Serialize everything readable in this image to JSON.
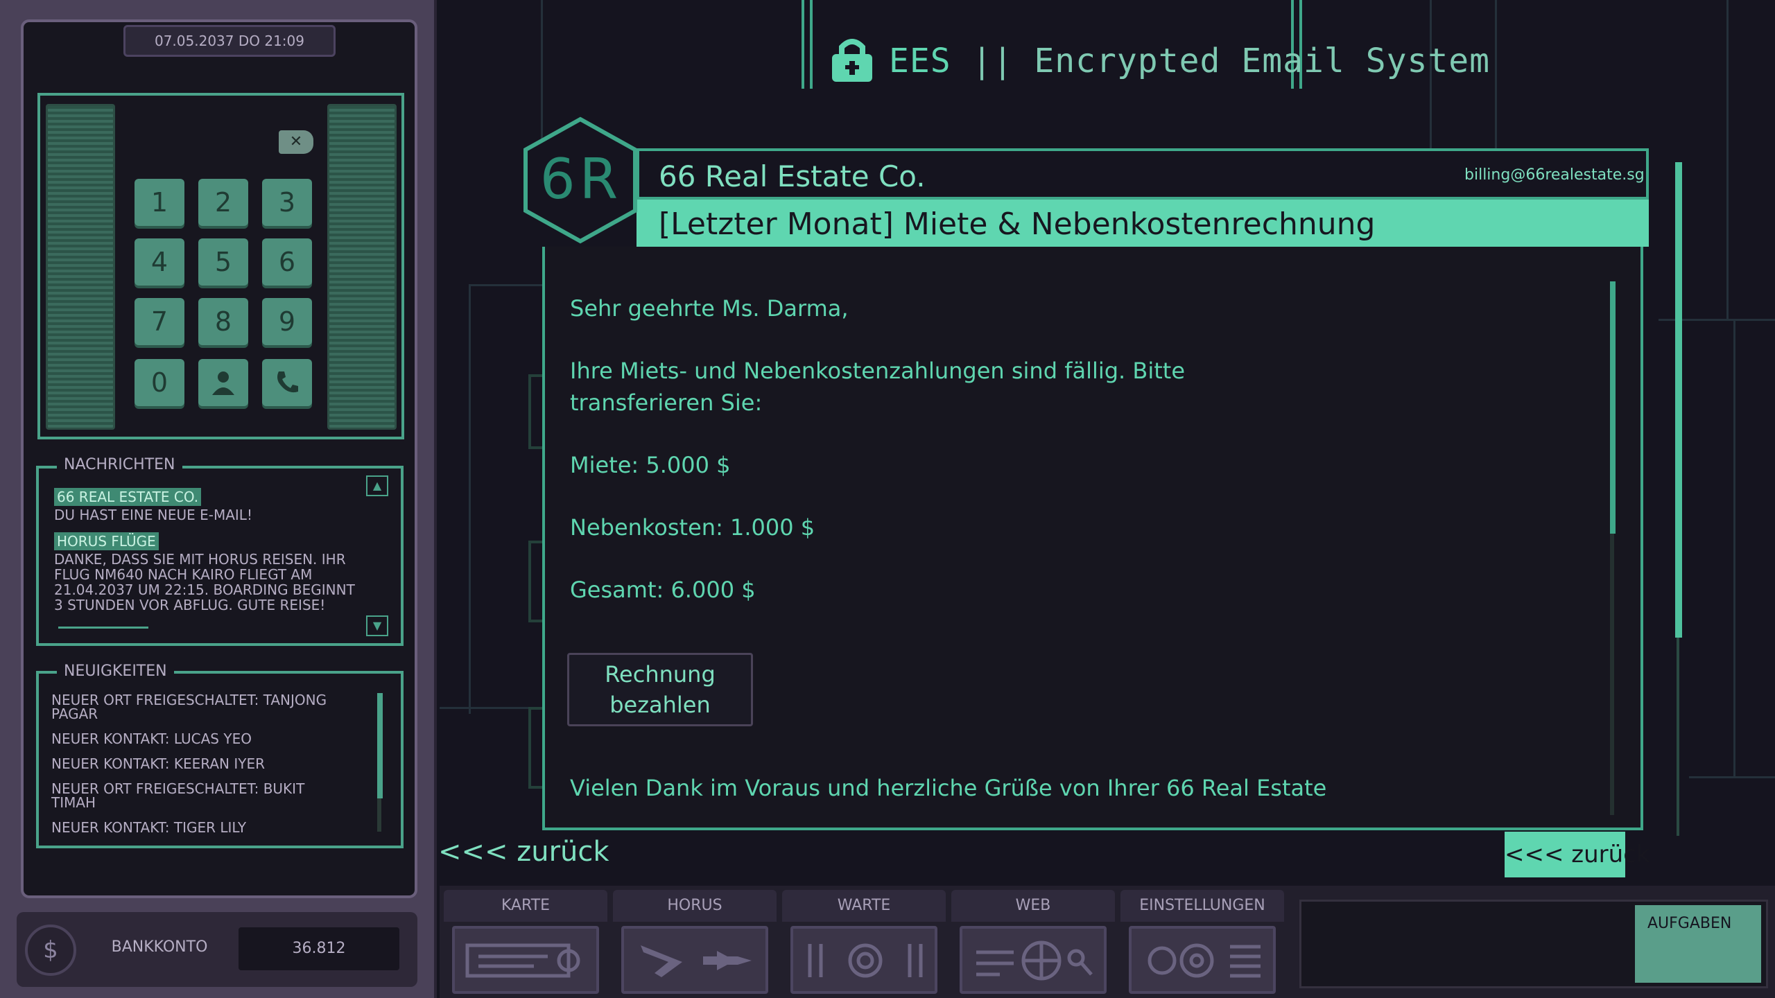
{
  "phone": {
    "datetime": "07.05.2037 DO 21:09",
    "keys": [
      "1",
      "2",
      "3",
      "4",
      "5",
      "6",
      "7",
      "8",
      "9",
      "0"
    ],
    "messages_title": "NACHRICHTEN",
    "messages": [
      {
        "sender": "66 REAL ESTATE CO.",
        "text": "DU HAST EINE NEUE E-MAIL!"
      },
      {
        "sender": "HORUS FLÜGE",
        "text": "DANKE, DASS SIE MIT HORUS REISEN. IHR FLUG NM640 NACH KAIRO FLIEGT AM 21.04.2037 UM 22:15. BOARDING BEGINNT 3 STUNDEN VOR ABFLUG. GUTE REISE!"
      }
    ],
    "news_title": "NEUIGKEITEN",
    "news": [
      "NEUER ORT FREIGESCHALTET: TANJONG PAGAR",
      "NEUER KONTAKT: LUCAS YEO",
      "NEUER KONTAKT: KEERAN IYER",
      "NEUER ORT FREIGESCHALTET: BUKIT TIMAH",
      "NEUER KONTAKT: TIGER LILY"
    ],
    "bank_label": "BANKKONTO",
    "bank_value": "36.812"
  },
  "ees": {
    "short": "EES",
    "separator": "||",
    "full": "Encrypted Email System"
  },
  "email": {
    "badge": "6R",
    "sender": "66 Real Estate Co.",
    "sender_address": "billing@66realestate.sg",
    "subject": "[Letzter Monat] Miete & Nebenkostenrechnung",
    "greeting": "Sehr geehrte Ms. Darma,",
    "para1_line1": "Ihre Miets- und Nebenkostenzahlungen sind fällig. Bitte",
    "para1_line2": "transferieren Sie:",
    "rent": "Miete: 5.000 $",
    "utilities": "Nebenkosten: 1.000 $",
    "total": "Gesamt: 6.000 $",
    "pay_button_line1": "Rechnung",
    "pay_button_line2": "bezahlen",
    "closing": "Vielen Dank im Voraus und herzliche Grüße von Ihrer 66 Real Estate"
  },
  "nav": {
    "back_left": "<<< zurück",
    "back_right": "<<< zurück"
  },
  "taskbar": {
    "tabs": [
      "KARTE",
      "HORUS",
      "WARTE",
      "WEB",
      "EINSTELLUNGEN"
    ],
    "tasks": "AUFGABEN"
  },
  "colors": {
    "accent": "#5fd6b0",
    "background": "#15141f",
    "phone_frame": "#4a4158"
  }
}
